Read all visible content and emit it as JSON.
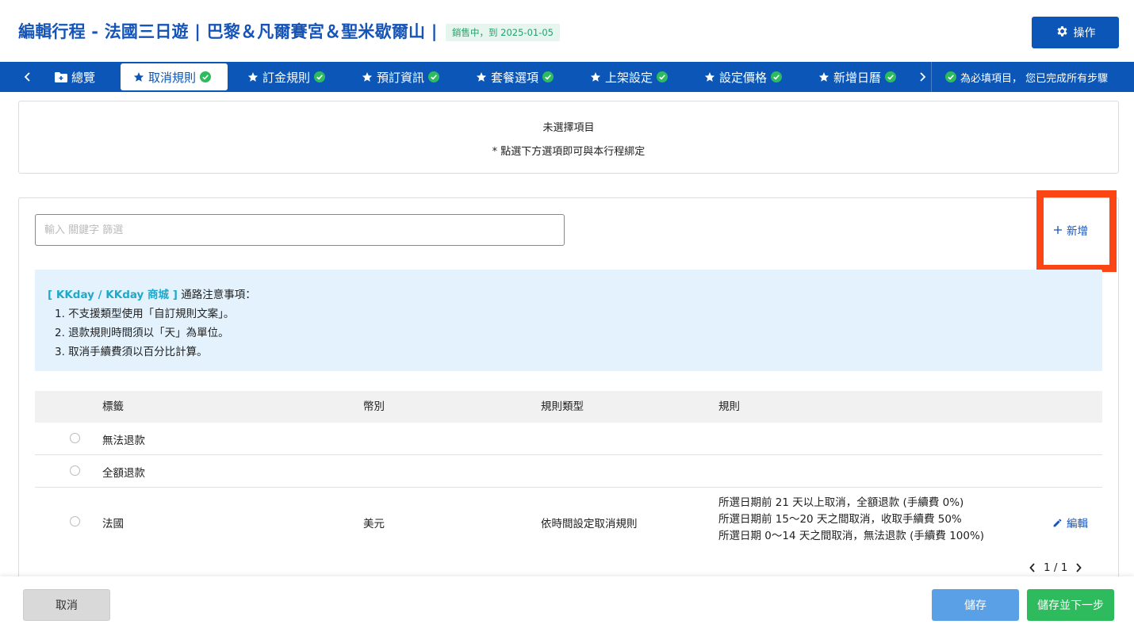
{
  "header": {
    "title": "編輯行程 - 法國三日遊 | 巴黎＆凡爾賽宮＆聖米歇爾山 |",
    "status": "銷售中，到 2025-01-05",
    "action_label": "操作"
  },
  "tabs": [
    {
      "label": "總覽",
      "icon": "folder-add-icon"
    },
    {
      "label": "取消規則",
      "icon": "star-icon",
      "done": true,
      "active": true
    },
    {
      "label": "訂金規則",
      "icon": "star-icon",
      "done": true
    },
    {
      "label": "預訂資訊",
      "icon": "star-icon",
      "done": true
    },
    {
      "label": "套餐選項",
      "icon": "star-icon",
      "done": true
    },
    {
      "label": "上架設定",
      "icon": "star-icon",
      "done": true
    },
    {
      "label": "設定價格",
      "icon": "star-icon",
      "done": true
    },
    {
      "label": "新增日曆",
      "icon": "star-icon",
      "done": true
    }
  ],
  "required_note": "為必填項目，  您已完成所有步驟",
  "selection": {
    "empty_text": "未選擇項目",
    "hint": "* 點選下方選項即可與本行程綁定"
  },
  "search": {
    "placeholder": "輸入 關鍵字 篩選",
    "value": ""
  },
  "add_label": "新增",
  "notice": {
    "tag": "[ KKday / KKday 商城 ]",
    "heading": "通路注意事項：",
    "items": [
      "1. 不支援類型使用「自訂規則文案」。",
      "2. 退款規則時間須以「天」為單位。",
      "3. 取消手續費須以百分比計算。"
    ]
  },
  "table": {
    "columns": [
      "標籤",
      "幣別",
      "規則類型",
      "規則"
    ],
    "rows": [
      {
        "label": "無法退款",
        "currency": "",
        "type": "",
        "rules": []
      },
      {
        "label": "全額退款",
        "currency": "",
        "type": "",
        "rules": []
      },
      {
        "label": "法國",
        "currency": "美元",
        "type": "依時間設定取消規則",
        "rules": [
          "所選日期前 21 天以上取消，全額退款 (手續費 0%)",
          "所選日期前 15～20 天之間取消，收取手續費 50%",
          "所選日期 0～14 天之間取消，無法退款 (手續費 100%)"
        ],
        "edit_label": "編輯"
      }
    ]
  },
  "pagination": {
    "text": "1 / 1"
  },
  "footer": {
    "cancel": "取消",
    "save": "儲存",
    "save_next": "儲存並下一步"
  },
  "colors": {
    "primary": "#0b56b6",
    "success": "#2dbb5d",
    "highlight": "#fc4514",
    "notice_bg": "#e3f2fc"
  }
}
